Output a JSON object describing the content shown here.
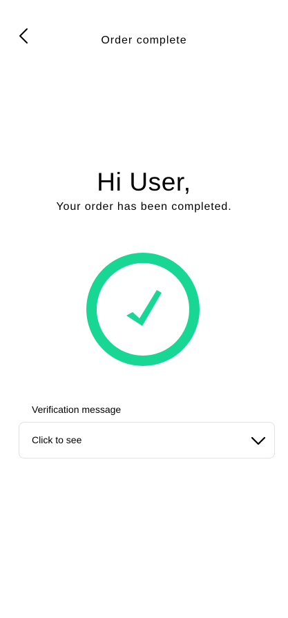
{
  "header": {
    "title": "Order complete",
    "back_icon": "chevron-left-icon"
  },
  "main": {
    "greeting": "Hi User,",
    "subtitle": "Your order has been completed.",
    "status_icon": "checkmark-circle-icon"
  },
  "verification": {
    "label": "Verification message",
    "value": "Click to see",
    "chevron_icon": "chevron-down-icon"
  },
  "colors": {
    "accent": "#18d795",
    "text": "#000000",
    "border": "#e2e2e2",
    "background": "#ffffff"
  }
}
